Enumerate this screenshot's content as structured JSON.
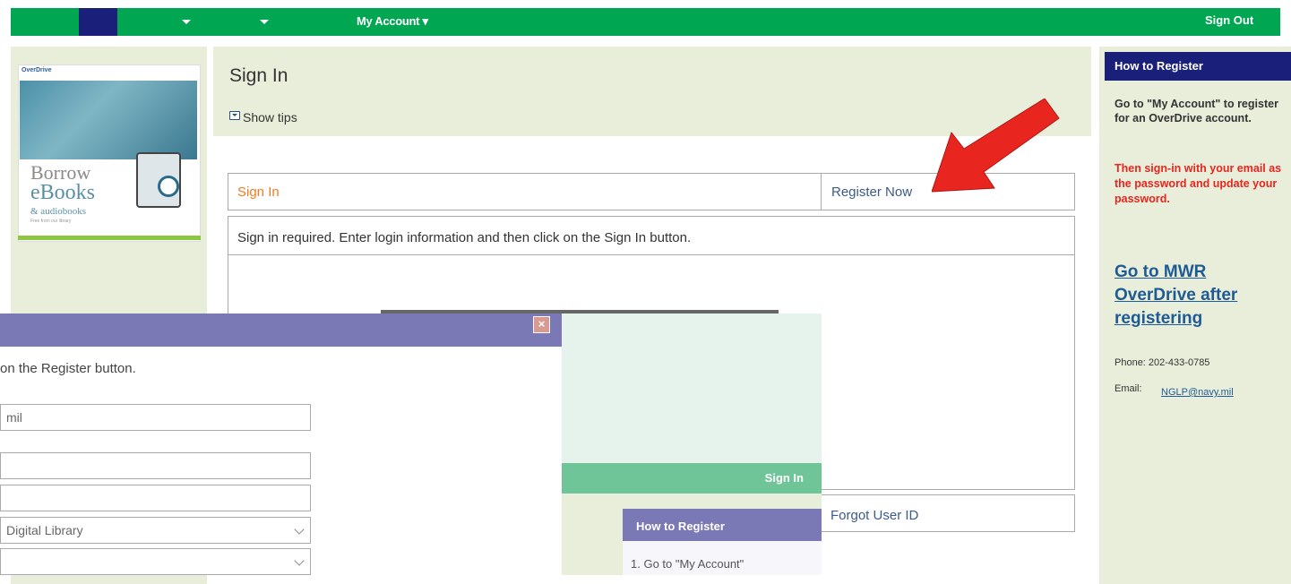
{
  "nav": {
    "my_account": "My Account ▾",
    "sign_out": "Sign Out"
  },
  "promo": {
    "logo": "OverDrive",
    "line1": "Borrow",
    "line2": "eBooks",
    "line3": "& audiobooks",
    "line4": "Free from our library"
  },
  "header": {
    "title": "Sign In",
    "show_tips": "Show tips"
  },
  "login": {
    "tab_signin": "Sign In",
    "tab_register": "Register Now",
    "info": "Sign in required. Enter login information and then click on the Sign In button.",
    "forgot_id": "Forgot User ID"
  },
  "sidebar": {
    "title": "How to Register",
    "step1": "Go to \"My Account\" to register for an OverDrive account.",
    "step2": "Then sign-in with your email as the password and update your password.",
    "link": "Go to MWR OverDrive after registering",
    "phone": "Phone: 202-433-0785",
    "email_label": "Email:",
    "email": "NGLP@navy.mil"
  },
  "dialog": {
    "text": "on the Register button.",
    "field1_value": "mil",
    "field2_value": "",
    "field3_value": "",
    "select1_value": "Digital Library",
    "select2_value": ""
  },
  "mid_panel": {
    "sign_in": "Sign In",
    "how_title": "How to Register",
    "step": "1. Go to \"My Account\""
  },
  "colors": {
    "nav_green": "#00a651",
    "nav_blue": "#1a1f7a",
    "dialog_purple": "#7b78b6",
    "accent_orange": "#f47920",
    "alert_red": "#e8251f"
  }
}
